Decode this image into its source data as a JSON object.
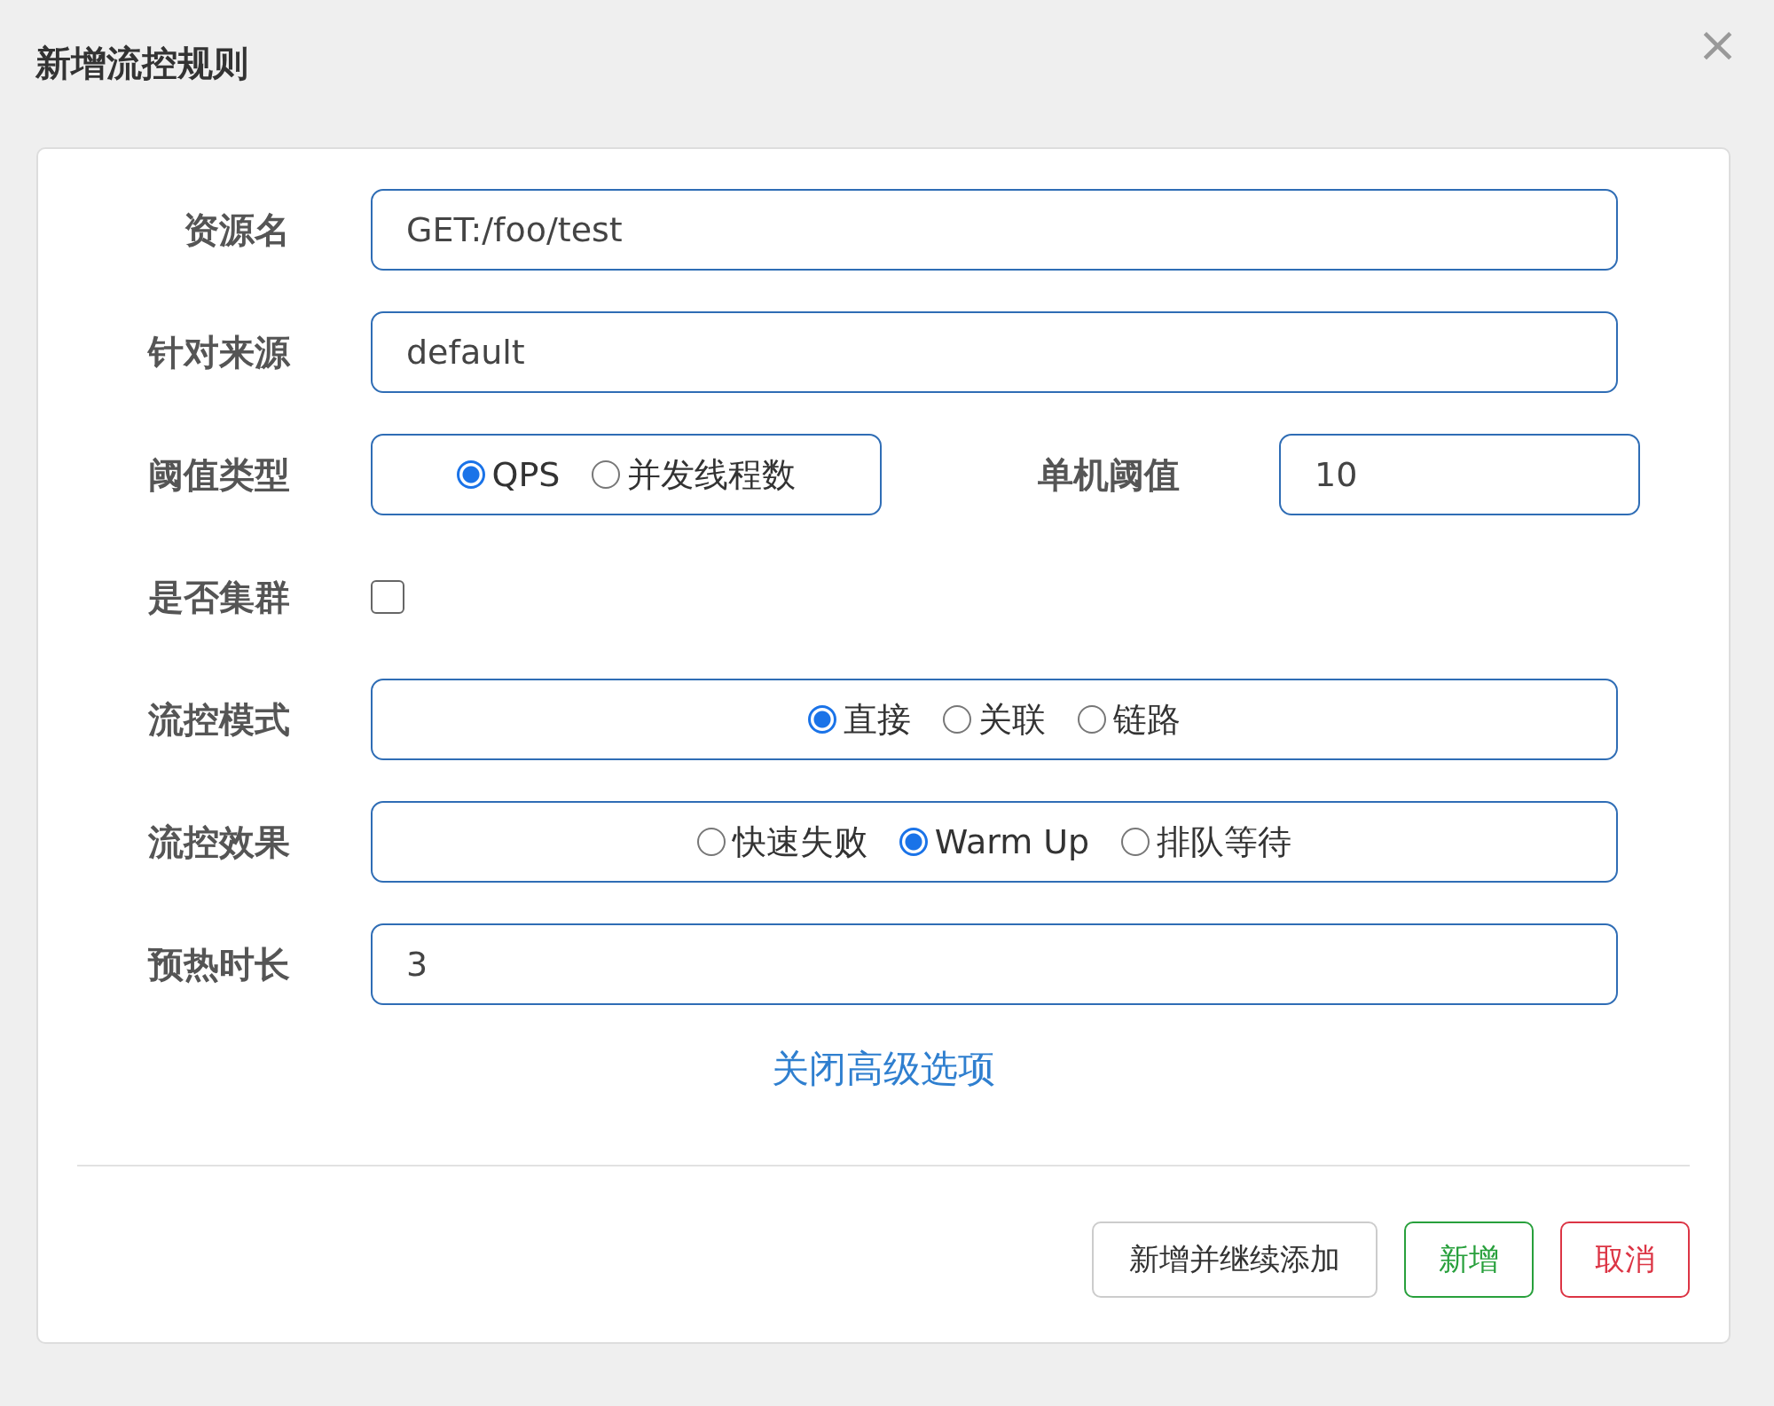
{
  "dialog": {
    "title": "新增流控规则",
    "close": "×"
  },
  "form": [
    {
      "kind": "text",
      "label": "资源名",
      "value": "GET:/foo/test"
    },
    {
      "kind": "text",
      "label": "针对来源",
      "value": "default"
    },
    {
      "kind": "radio_with_field",
      "label": "阈值类型",
      "options": [
        {
          "label": "QPS",
          "selected": true
        },
        {
          "label": "并发线程数",
          "selected": false
        }
      ],
      "field_label": "单机阈值",
      "field_value": "10"
    },
    {
      "kind": "checkbox",
      "label": "是否集群",
      "checked": false
    },
    {
      "kind": "radio",
      "label": "流控模式",
      "options": [
        {
          "label": "直接",
          "selected": true
        },
        {
          "label": "关联",
          "selected": false
        },
        {
          "label": "链路",
          "selected": false
        }
      ]
    },
    {
      "kind": "radio",
      "label": "流控效果",
      "options": [
        {
          "label": "快速失败",
          "selected": false
        },
        {
          "label": "Warm Up",
          "selected": true
        },
        {
          "label": "排队等待",
          "selected": false
        }
      ]
    },
    {
      "kind": "text",
      "label": "预热时长",
      "value": "3"
    }
  ],
  "advanced_link": "关闭高级选项",
  "buttons": [
    {
      "kind": "default",
      "label": "新增并继续添加"
    },
    {
      "kind": "success",
      "label": "新增"
    },
    {
      "kind": "danger",
      "label": "取消"
    }
  ]
}
